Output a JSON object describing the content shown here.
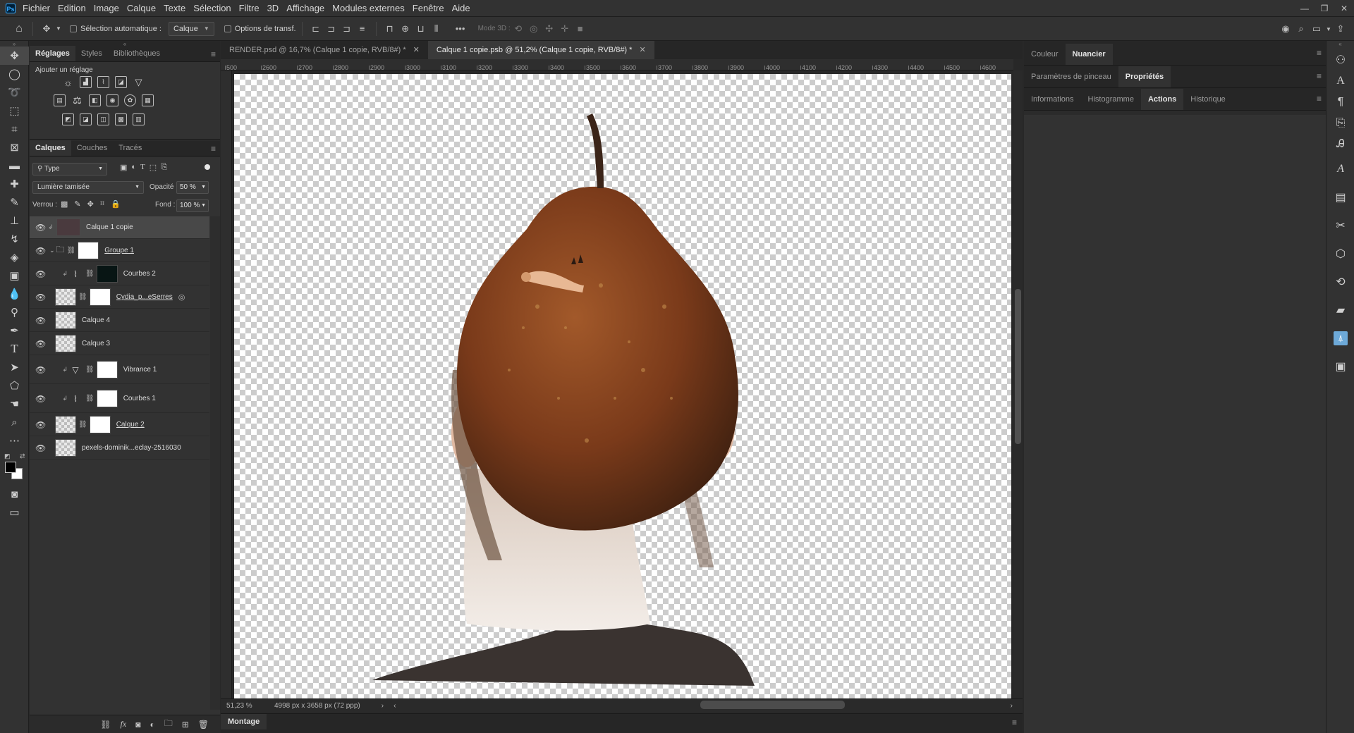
{
  "app": {
    "logo": "Ps"
  },
  "menu": [
    "Fichier",
    "Edition",
    "Image",
    "Calque",
    "Texte",
    "Sélection",
    "Filtre",
    "3D",
    "Affichage",
    "Modules externes",
    "Fenêtre",
    "Aide"
  ],
  "options_bar": {
    "auto_select_label": "Sélection automatique :",
    "auto_select_value": "Calque",
    "transform_label": "Options de transf.",
    "mode3d_label": "Mode 3D :",
    "more": "•••"
  },
  "left_panel": {
    "tabs": [
      "Réglages",
      "Styles",
      "Bibliothèques"
    ],
    "active_tab": "Réglages",
    "adjust_title": "Ajouter un réglage",
    "layers_tabs": [
      "Calques",
      "Couches",
      "Tracés"
    ],
    "active_layers_tab": "Calques",
    "filter_kind": "Type",
    "blend_mode": "Lumière tamisée",
    "opacity_label": "Opacité :",
    "opacity_value": "50 %",
    "lock_label": "Verrou :",
    "fill_label": "Fond :",
    "fill_value": "100 %",
    "layers": [
      {
        "name": "Calque 1 copie",
        "selected": true
      },
      {
        "name": "Groupe 1"
      },
      {
        "name": "Courbes 2"
      },
      {
        "name": "Cydia_p...eSerres"
      },
      {
        "name": "Calque 4"
      },
      {
        "name": "Calque 3"
      },
      {
        "name": "Vibrance 1"
      },
      {
        "name": "Courbes 1"
      },
      {
        "name": "Calque 2"
      },
      {
        "name": "pexels-dominik...eclay-2516030"
      }
    ],
    "bottom_fx": "fx"
  },
  "document": {
    "tabs": [
      {
        "label": "RENDER.psd @ 16,7% (Calque 1 copie, RVB/8#) *",
        "active": false
      },
      {
        "label": "Calque 1 copie.psb @ 51,2% (Calque 1 copie, RVB/8#) *",
        "active": true
      }
    ],
    "ruler_marks": [
      "500",
      "2600",
      "2700",
      "2800",
      "2900",
      "3000",
      "3100",
      "3200",
      "3300",
      "3400",
      "3500",
      "3600",
      "3700",
      "3800",
      "3900",
      "4000",
      "4100",
      "4200",
      "4300",
      "4400",
      "4500",
      "4600"
    ],
    "zoom": "51,23 %",
    "doc_info": "4998 px x 3658 px (72 ppp)",
    "montage_label": "Montage"
  },
  "right_panel": {
    "row1": [
      "Couleur",
      "Nuancier"
    ],
    "row1_active": "Nuancier",
    "row2": [
      "Paramètres de pinceau",
      "Propriétés"
    ],
    "row2_active": "Propriétés",
    "row3": [
      "Informations",
      "Histogramme",
      "Actions",
      "Historique"
    ],
    "row3_active": "Actions"
  },
  "colors": {
    "foreground": "#000000",
    "background": "#ffffff",
    "accent": "#31a8ff"
  }
}
